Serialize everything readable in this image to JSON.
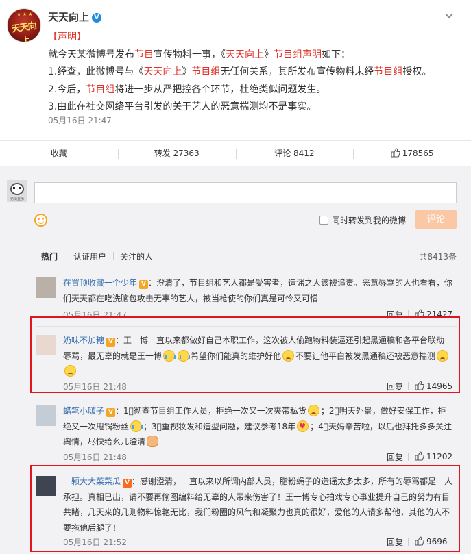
{
  "post": {
    "author": "天天向上",
    "verified_mark": "V",
    "avatar_text": "天天向上",
    "lines": [
      [
        {
          "t": "【",
          "c": "red"
        },
        {
          "t": "声明",
          "c": "red"
        },
        {
          "t": "】",
          "c": "red"
        }
      ],
      [
        {
          "t": "就今天某微博号发布"
        },
        {
          "t": "节目",
          "c": "red"
        },
        {
          "t": "宣传物料一事，《"
        },
        {
          "t": "天天向上",
          "c": "red"
        },
        {
          "t": "》"
        },
        {
          "t": "节目组声明",
          "c": "red"
        },
        {
          "t": "如下："
        }
      ],
      [
        {
          "t": "1.经查，此微博号与《"
        },
        {
          "t": "天天向上",
          "c": "red"
        },
        {
          "t": "》"
        },
        {
          "t": "节目组",
          "c": "red"
        },
        {
          "t": "无任何关系，其所发布宣传物料未经"
        },
        {
          "t": "节目组",
          "c": "red"
        },
        {
          "t": "授权。"
        }
      ],
      [
        {
          "t": "2.今后，"
        },
        {
          "t": "节目组",
          "c": "red"
        },
        {
          "t": "将进一步从严把控各个环节，杜绝类似问题发生。"
        }
      ],
      [
        {
          "t": "3.由此在社交网络平台引发的关于艺人的恶意揣测均不是事实。"
        }
      ]
    ],
    "time": "05月16日 21:47"
  },
  "actions": {
    "favorite": "收藏",
    "repost": "转发 27363",
    "comment": "评论 8412",
    "like": "178565"
  },
  "composer": {
    "me_avatar_caption": "无法显示",
    "input_placeholder": "",
    "repost_label": "同时转发到我的微博",
    "submit": "评论"
  },
  "tabs": {
    "hot": "热门",
    "verified": "认证用户",
    "following": "关注的人",
    "total": "共8413条"
  },
  "comments": [
    {
      "user": "在置顶收藏一个少年",
      "badge": "V",
      "lines": [
        [
          {
            "t": "：澄清了，节目组和艺人都是受害者，造谣之人该被追责。恶意辱骂的人也看看，你"
          }
        ],
        [
          {
            "t": "们天天都在吃洗脑包攻击无辜的艺人，被当枪使的你们真是可怜又可憎"
          }
        ]
      ],
      "time": "05月16日 21:47",
      "reply": "回复",
      "likes": "21427"
    },
    {
      "user": "奶味不加糖",
      "badge": "V",
      "lines": [
        [
          {
            "t": "：王一博一直以来都做好自己本职工作，这次被人偷跑物料装逼还引起黑通稿和各平台联动"
          }
        ],
        [
          {
            "t": "辱骂，最无辜的就是王一博"
          },
          {
            "e": "cry"
          },
          {
            "e": "cry"
          },
          {
            "t": "希望你们能真的维护好他"
          },
          {
            "e": "sad"
          },
          {
            "t": "不要让他平白被发黑通稿还被恶意揣测"
          },
          {
            "e": "sad"
          }
        ],
        [
          {
            "e": "sad"
          }
        ]
      ],
      "time": "05月16日 21:48",
      "reply": "回复",
      "likes": "14965"
    },
    {
      "user": "蜡笔小啵子",
      "badge": "V",
      "lines": [
        [
          {
            "t": "：1⃣彻查节目组工作人员，拒绝一次又一次夹带私货"
          },
          {
            "e": "sad"
          },
          {
            "t": "；2⃣明天外景，做好安保工作，拒"
          }
        ],
        [
          {
            "t": "绝又一次甩锅粉丝"
          },
          {
            "e": "cry"
          },
          {
            "t": "；3⃣重视妆发和造型问题，建议参考18年"
          },
          {
            "e": "heart"
          },
          {
            "t": "；4⃣天妈辛苦啦，以后也拜托多多关注"
          }
        ],
        [
          {
            "t": "舆情，尽快给幺儿澄清"
          },
          {
            "e": "fist"
          }
        ]
      ],
      "time": "05月16日 21:48",
      "reply": "回复",
      "likes": "11202"
    },
    {
      "user": "一颗大大菜菜瓜",
      "badge": "V",
      "lines": [
        [
          {
            "t": "：感谢澄清，一直以来以所谓内部人员，脂粉蝇子的造谣太多太多，所有的辱骂都是一人"
          }
        ],
        [
          {
            "t": "承担。真相已出，请不要再偷图编料给无辜的人带来伤害了！王一博专心拍戏专心事业提升自己的努力有目"
          }
        ],
        [
          {
            "t": "共睹，几天来的几则物料惊艳无比，我们粉圈的风气和凝聚力也真的很好，爱他的人请多帮他，其他的人不"
          }
        ],
        [
          {
            "t": "要拖他后腿了！"
          }
        ]
      ],
      "time": "05月16日 21:52",
      "reply": "回复",
      "likes": "9696"
    }
  ],
  "colors": {
    "accent_red": "#e0332a",
    "name_orange": "#eb7350",
    "highlight_box": "#e0151f",
    "submit_disabled": "#fbc8a5"
  },
  "icons": {
    "more": "chevron-down-icon",
    "like": "thumb-up-icon",
    "emoji": "smiley-icon"
  }
}
